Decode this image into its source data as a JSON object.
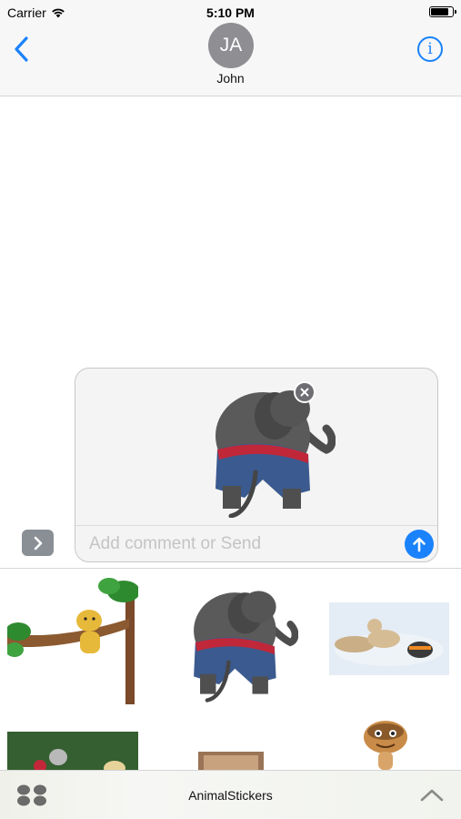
{
  "status_bar": {
    "carrier": "Carrier",
    "time": "5:10 PM",
    "battery_level": 0.75
  },
  "header": {
    "contact_initials": "JA",
    "contact_name": "John",
    "back_icon": "chevron-left-icon",
    "info_icon": "info-icon"
  },
  "compose": {
    "placeholder": "Add comment or Send",
    "attached_sticker": "elephant",
    "send_icon": "arrow-up-icon",
    "toggle_icon": "chevron-right-icon",
    "remove_icon": "close-icon"
  },
  "stickers": [
    {
      "name": "cat-on-branch"
    },
    {
      "name": "elephant"
    },
    {
      "name": "cats-sunbathing"
    },
    {
      "name": "cat-on-green"
    },
    {
      "name": "partial-sticker"
    },
    {
      "name": "meerkat"
    }
  ],
  "app_bar": {
    "app_name": "AnimalStickers",
    "apps_icon": "app-grid-icon",
    "expand_icon": "chevron-up-icon"
  },
  "colors": {
    "accent": "#1a82fb",
    "avatar": "#8e8e93",
    "header_bg": "#f7f7f7"
  }
}
